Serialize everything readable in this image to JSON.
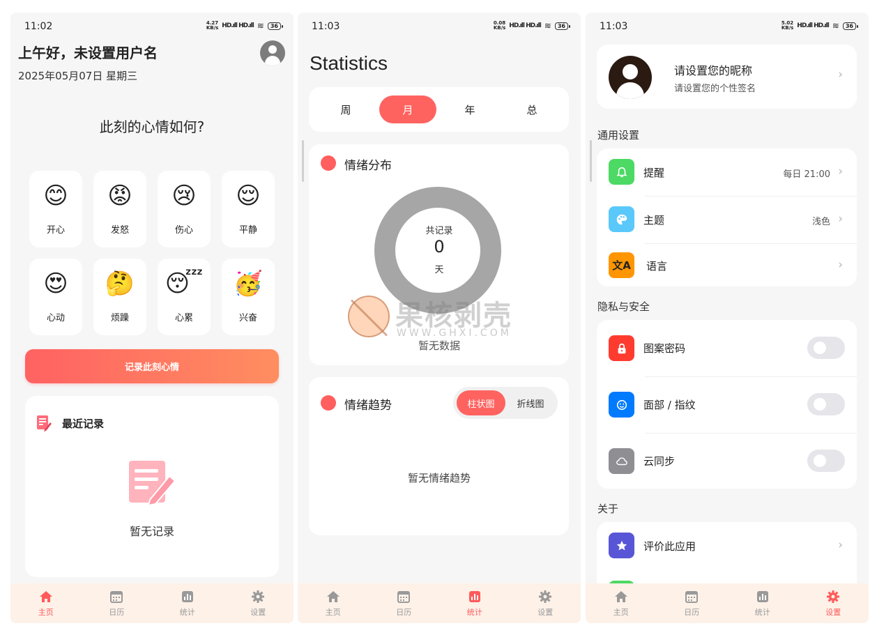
{
  "status": {
    "p1": {
      "time": "11:02",
      "speed_top": "4.27",
      "speed_bottom": "KB/s",
      "battery": "36"
    },
    "p2": {
      "time": "11:03",
      "speed_top": "0.08",
      "speed_bottom": "KB/s",
      "battery": "36"
    },
    "p3": {
      "time": "11:03",
      "speed_top": "5.02",
      "speed_bottom": "KB/s",
      "battery": "36"
    },
    "signal": "HD.ıll HD.ıll",
    "wifi": "≋"
  },
  "home": {
    "greeting": "上午好，未设置用户名",
    "date": "2025年05月07日 星期三",
    "question": "此刻的心情如何?",
    "moods": [
      {
        "emoji": "😊",
        "label": "开心"
      },
      {
        "emoji": "😡",
        "label": "发怒"
      },
      {
        "emoji": "😢",
        "label": "伤心"
      },
      {
        "emoji": "😌",
        "label": "平静"
      },
      {
        "emoji": "😍",
        "label": "心动"
      },
      {
        "emoji": "🤔",
        "label": "烦躁"
      },
      {
        "emoji": "😴",
        "label": "心累"
      },
      {
        "emoji": "🥳",
        "label": "兴奋"
      }
    ],
    "record_button": "记录此刻心情",
    "recent_title": "最近记录",
    "empty_text": "暂无记录"
  },
  "tabs": [
    "主页",
    "日历",
    "统计",
    "设置"
  ],
  "stats": {
    "title": "Statistics",
    "periods": [
      "周",
      "月",
      "年",
      "总"
    ],
    "active_period": "月",
    "dist_title": "情绪分布",
    "total_label": "共记录",
    "total_value": "0",
    "total_unit": "天",
    "no_data": "暂无数据",
    "trend_title": "情绪趋势",
    "trend_types": [
      "柱状图",
      "折线图"
    ],
    "no_trend": "暂无情绪趋势",
    "watermark_big": "果核剥壳",
    "watermark_small": "WWW.GHXI.COM"
  },
  "settings": {
    "nickname": "请设置您的昵称",
    "signature": "请设置您的个性签名",
    "general_title": "通用设置",
    "reminder_label": "提醒",
    "reminder_value": "每日 21:00",
    "theme_label": "主题",
    "theme_value": "浅色",
    "language_label": "语言",
    "privacy_title": "隐私与安全",
    "pattern_label": "图案密码",
    "face_label": "面部 / 指纹",
    "cloud_label": "云同步",
    "about_title": "关于",
    "rate_label": "评价此应用",
    "language_icon": "文A"
  },
  "colors": {
    "accent": "#ff6360",
    "tabbar_bg": "#fdf1e8",
    "reminder_icon": "#4cd964",
    "theme_icon": "#5ac8fa",
    "language_icon": "#ff9500",
    "pattern_icon": "#ff3b30",
    "face_icon": "#007aff",
    "cloud_icon": "#8e8e93",
    "rate_icon": "#5856d6"
  }
}
